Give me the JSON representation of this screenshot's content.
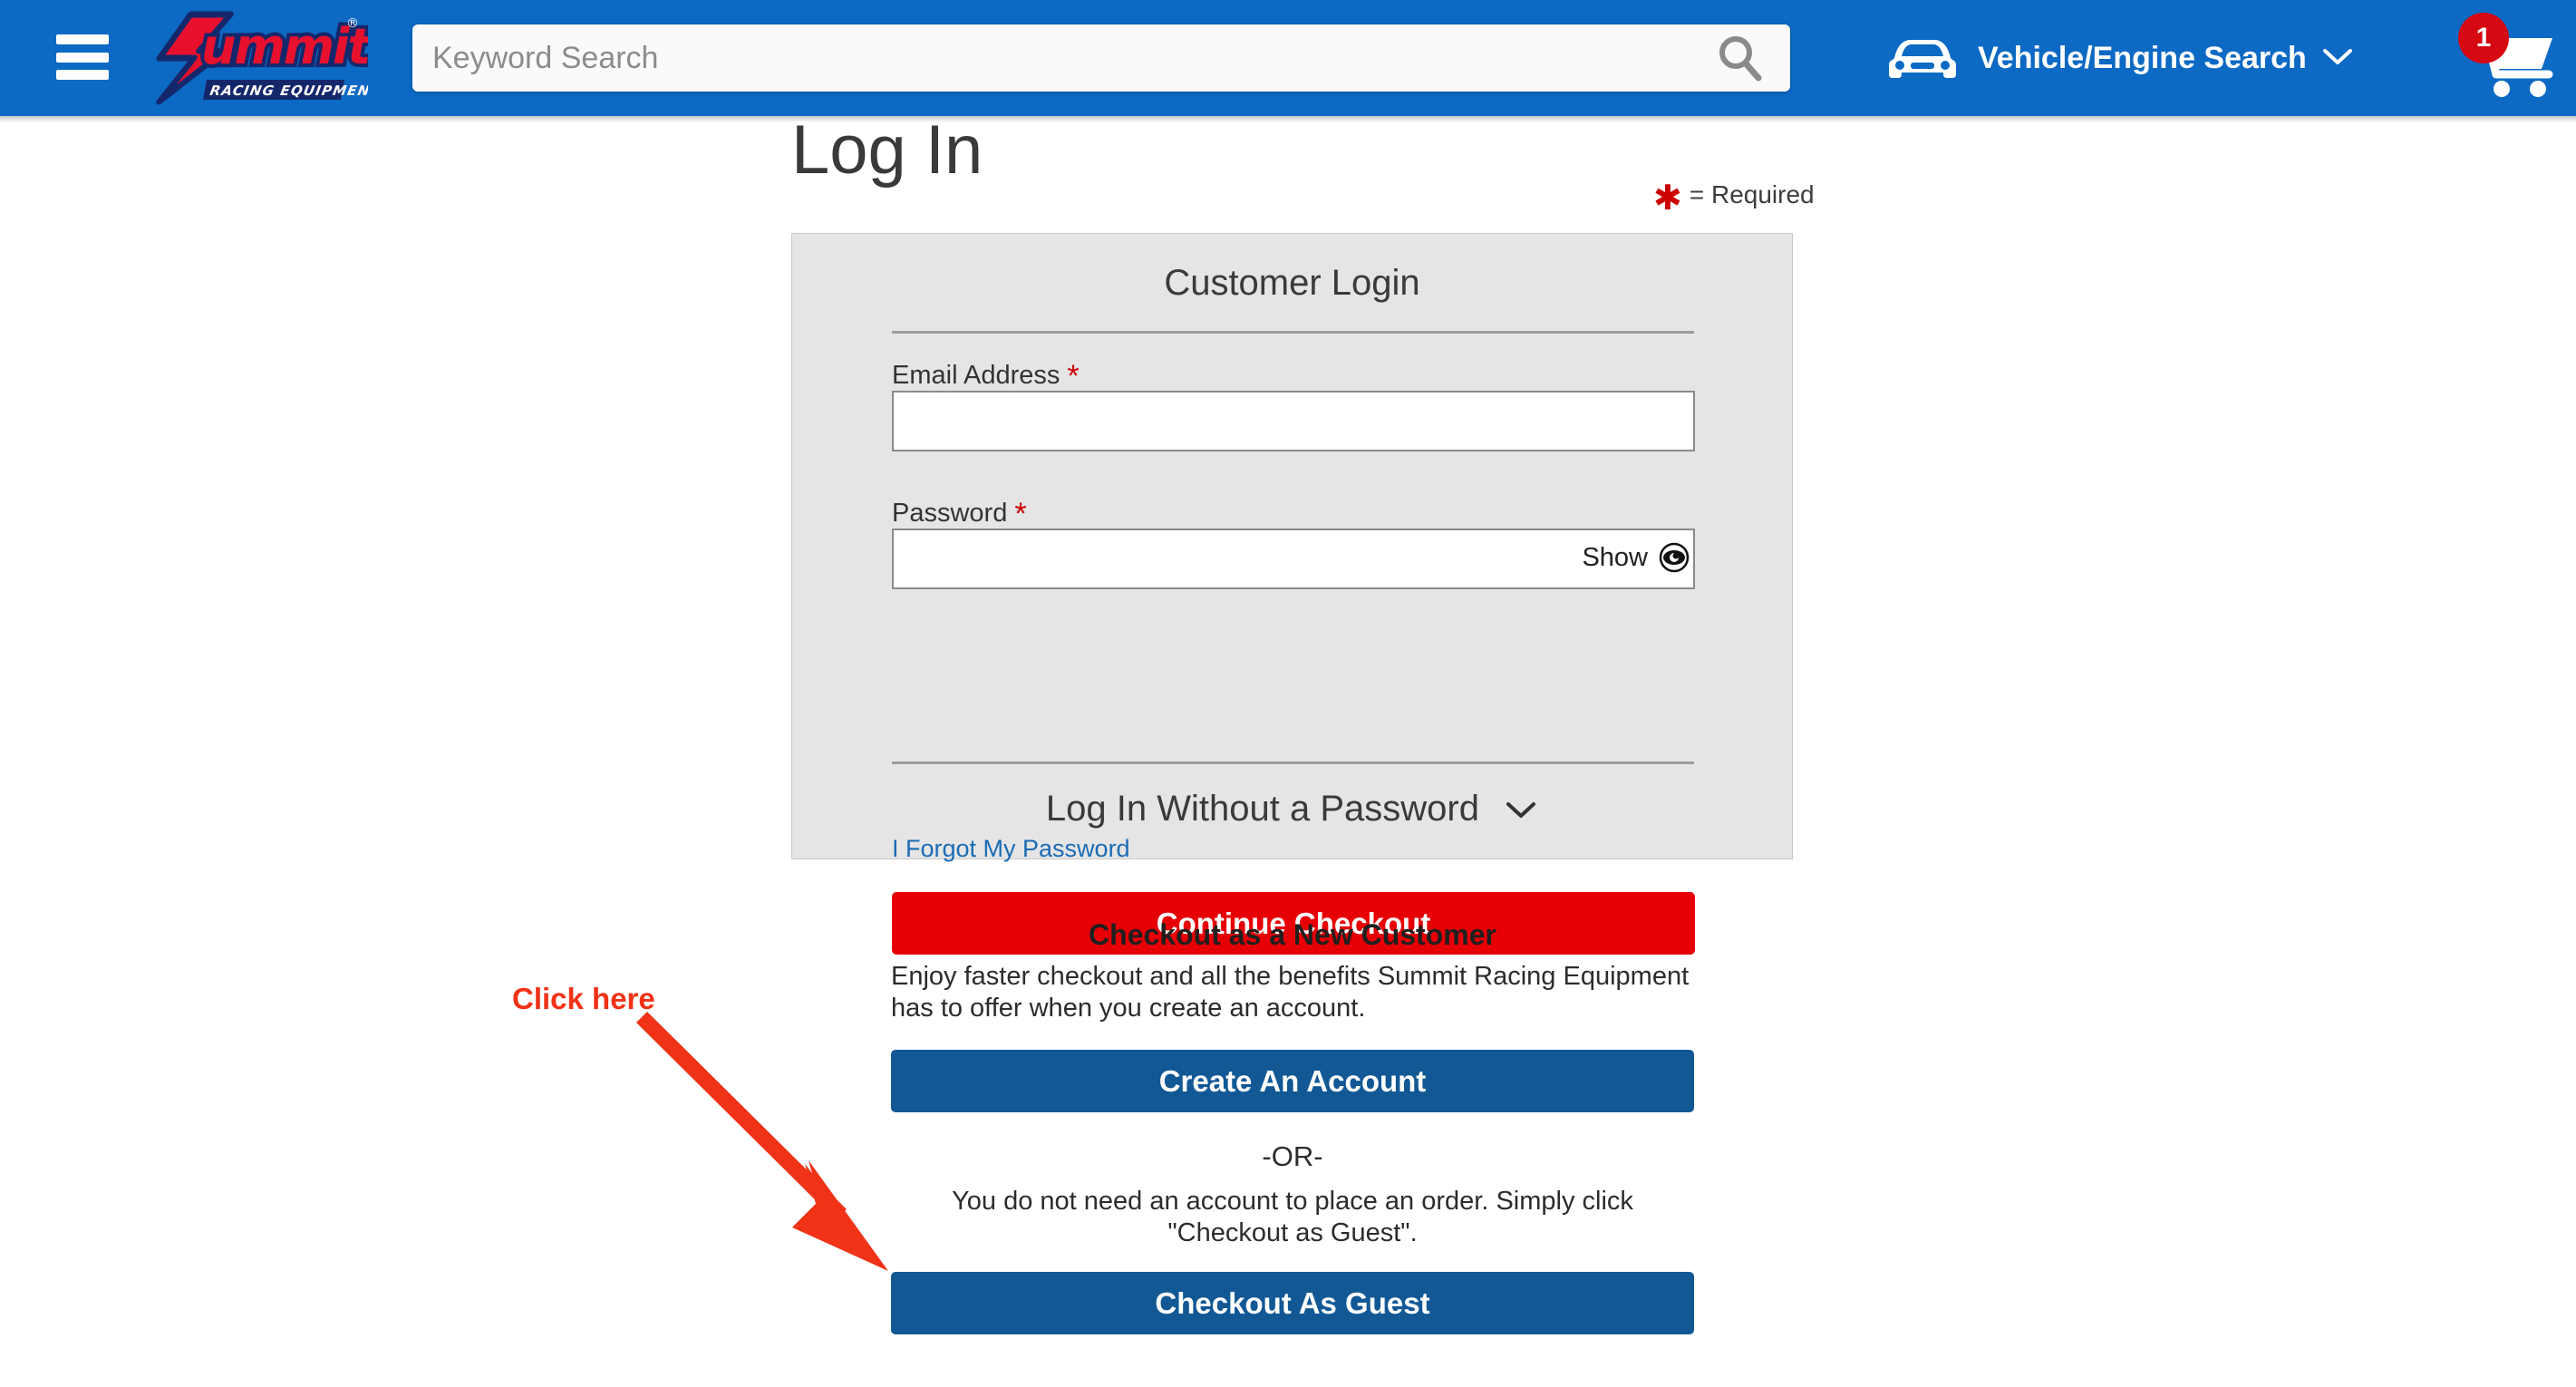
{
  "header": {
    "menu_icon": "hamburger-menu-icon",
    "logo": {
      "wordmark": "Summit",
      "tagline": "RACING EQUIPMENT",
      "registered": "®"
    },
    "search": {
      "placeholder": "Keyword Search",
      "value": "",
      "icon": "search-icon"
    },
    "vehicle_search": {
      "label": "Vehicle/Engine Search",
      "icon": "car-icon",
      "chevron": "⌄"
    },
    "cart": {
      "count": "1",
      "icon": "shopping-cart-icon"
    },
    "colors": {
      "header_blue": "#0c69c4",
      "badge_red": "#D60812"
    }
  },
  "page": {
    "title": "Log In",
    "required_note": "= Required",
    "required_star": "✱"
  },
  "login_card": {
    "title": "Customer Login",
    "email": {
      "label": "Email Address",
      "required_star": "*",
      "value": "",
      "placeholder": ""
    },
    "password": {
      "label": "Password",
      "required_star": "*",
      "value": "",
      "placeholder": "",
      "show_label": "Show",
      "show_icon": "eye-icon"
    },
    "forgot_link": "I Forgot My Password",
    "continue_button": "Continue Checkout",
    "passwordless_label": "Log In Without a Password",
    "passwordless_chevron": "⌄"
  },
  "new_customer": {
    "title": "Checkout as a New Customer",
    "description": "Enjoy faster checkout and all the benefits Summit Racing Equipment has to offer when you create an account.",
    "create_button": "Create An Account",
    "or_text": "-OR-",
    "guest_description": "You do not need an account to place an order. Simply click \"Checkout as Guest\".",
    "guest_button": "Checkout As Guest"
  },
  "annotation": {
    "text": "Click here",
    "color": "#F03217"
  },
  "colors": {
    "primary_blue": "#115895",
    "action_red": "#E60005",
    "card_gray": "#E5E5E5",
    "link_blue": "#1b6bb5"
  }
}
